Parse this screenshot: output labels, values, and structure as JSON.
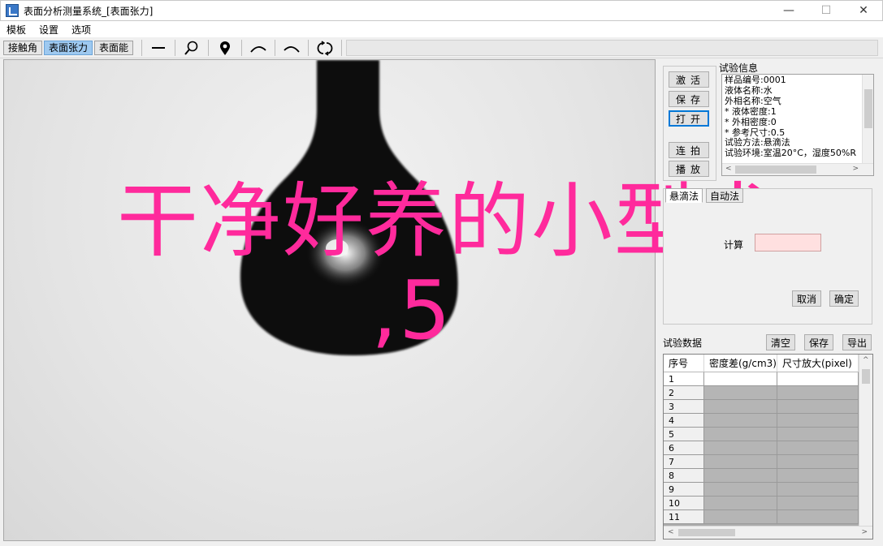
{
  "window": {
    "title": "表面分析测量系统_[表面张力]",
    "controls": {
      "minimize": "—",
      "maximize": "☐",
      "close": "✕"
    }
  },
  "menu": [
    "模板",
    "设置",
    "选项"
  ],
  "toolbar": {
    "mode_tabs": [
      "接触角",
      "表面张力",
      "表面能"
    ],
    "active_mode": "表面张力",
    "tools": [
      "line-icon",
      "zoom-icon",
      "location-pin-icon",
      "arc-up-icon",
      "arc-down-icon",
      "refresh-icon"
    ]
  },
  "side_buttons": {
    "activate": "激活",
    "save": "保存",
    "open": "打开",
    "capture": "连拍",
    "playback": "播放"
  },
  "info": {
    "label": "试验信息",
    "lines": [
      "样品编号:0001",
      "液体名称:水",
      "外相名称:空气",
      "* 液体密度:1",
      "* 外相密度:0",
      "* 参考尺寸:0.5",
      "试验方法:悬滴法",
      "试验环境:室温20°C，湿度50%R"
    ]
  },
  "method": {
    "tabs": [
      "悬滴法",
      "自动法"
    ],
    "calc_label": "计算",
    "cancel": "取消",
    "confirm": "确定"
  },
  "data_section": {
    "label": "试验数据",
    "clear": "清空",
    "save": "保存",
    "export": "导出",
    "columns": [
      "序号",
      "密度差(g/cm3)",
      "尺寸放大(pixel)"
    ],
    "rows": [
      "1",
      "2",
      "3",
      "4",
      "5",
      "6",
      "7",
      "8",
      "9",
      "10",
      "11"
    ]
  },
  "overlay": {
    "line1": "干净好养的小型犬",
    "line2": ",5"
  },
  "colors": {
    "overlay_text": "#ff2a9c",
    "active_tab": "#9ec9f0",
    "focus": "#0078d7",
    "grid_cell": "#b5b5b5"
  }
}
